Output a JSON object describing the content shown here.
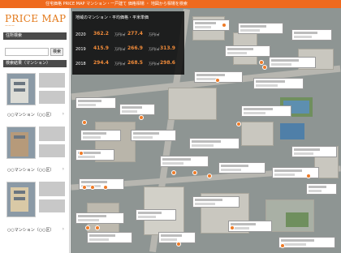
{
  "topbar": {
    "text": "住宅価格 PRICE MAP マンション・一戸建て 価格相場 ・ 地図から相場を検索"
  },
  "logo": {
    "text": "PRICE MAP",
    "sub": "ーーー"
  },
  "sidebar": {
    "area_header": "住所検索",
    "search_button": "検索",
    "list_header": "検索結果（マンション）",
    "items": [
      {
        "label": "○○マンション（○○区）"
      },
      {
        "label": "○○マンション（○○区）"
      },
      {
        "label": "○○マンション（○○区）"
      }
    ]
  },
  "panel": {
    "title": "地域のマンション・平均価格・平米単価",
    "rows": [
      {
        "year": "2020",
        "v1": "362.2",
        "v2": "277.4"
      },
      {
        "year": "2019",
        "v1": "415.9",
        "v2": "266.9",
        "v3": "313.9"
      },
      {
        "year": "2018",
        "v1": "294.4",
        "v2": "268.5",
        "v3": "298.6"
      }
    ],
    "unit": "万円/㎡"
  },
  "colors": {
    "accent": "#ef6a1e",
    "pin": "#ef7b27",
    "value": "#f08b3a"
  }
}
